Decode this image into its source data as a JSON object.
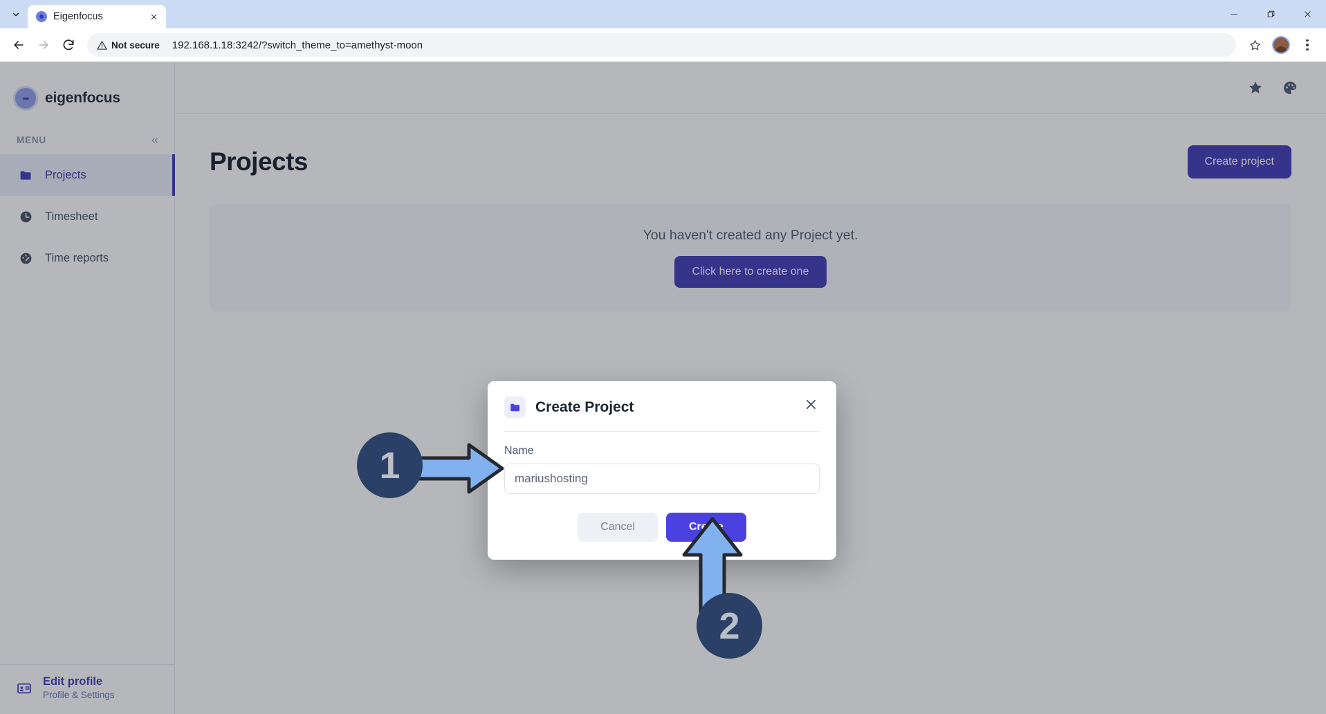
{
  "browser": {
    "tab": {
      "title": "Eigenfocus",
      "favicon_icon": "eigenfocus-favicon",
      "close_icon": "close-icon"
    },
    "tab_list_icon": "chevron-down-icon",
    "window_controls": [
      {
        "name": "minimize",
        "icon": "minimize-icon",
        "glyph": "—"
      },
      {
        "name": "maximize",
        "icon": "restore-icon",
        "glyph": "❐"
      },
      {
        "name": "close",
        "icon": "close-icon",
        "glyph": "✕"
      }
    ],
    "toolbar": {
      "back_icon": "back-arrow-icon",
      "forward_icon": "forward-arrow-icon",
      "reload_icon": "reload-icon",
      "security_label": "Not secure",
      "security_icon": "warning-triangle-icon",
      "url": "192.168.1.18:3242/?switch_theme_to=amethyst-moon",
      "bookmark_icon": "star-outline-icon",
      "profile_icon": "avatar-icon",
      "menu_icon": "three-dot-menu-icon"
    }
  },
  "sidebar": {
    "brand": "eigenfocus",
    "brand_icon": "eigenfocus-logo",
    "menu_label": "MENU",
    "collapse_icon": "double-chevron-left-icon",
    "collapse_glyph": "«",
    "items": [
      {
        "label": "Projects",
        "icon": "folder-icon",
        "active": true
      },
      {
        "label": "Timesheet",
        "icon": "clock-icon",
        "active": false
      },
      {
        "label": "Time reports",
        "icon": "gauge-icon",
        "active": false
      }
    ],
    "footer": {
      "title": "Edit profile",
      "subtitle": "Profile & Settings",
      "icon": "id-card-icon"
    }
  },
  "topbar": {
    "star_icon": "star-filled-icon",
    "theme_icon": "palette-icon"
  },
  "main": {
    "page_title": "Projects",
    "create_project_button": "Create project",
    "empty_state_text": "You haven't created any Project yet.",
    "empty_state_button": "Click here to create one"
  },
  "modal": {
    "icon": "folder-icon",
    "title": "Create Project",
    "close_icon": "close-icon",
    "field_label": "Name",
    "field_value": "mariushosting",
    "field_placeholder": "",
    "cancel_button": "Cancel",
    "create_button": "Create"
  },
  "annotations": [
    {
      "number": "1",
      "direction": "right",
      "target": "name-input"
    },
    {
      "number": "2",
      "direction": "up",
      "target": "create-button"
    }
  ],
  "colors": {
    "accent": "#3c35b5",
    "accent_bright": "#4b41e0",
    "badge": "#2a4066",
    "arrow_fill": "#82b1f0",
    "arrow_stroke": "#25292e",
    "tabstrip": "#ccdcf5"
  }
}
